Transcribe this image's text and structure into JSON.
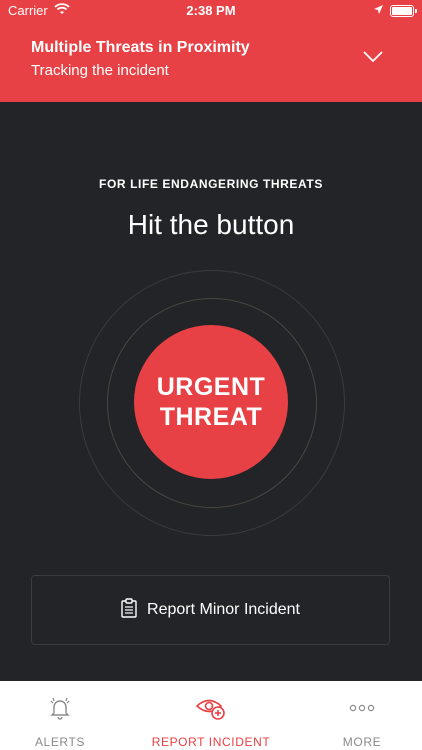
{
  "status_bar": {
    "carrier": "Carrier",
    "time": "2:38 PM"
  },
  "banner": {
    "title": "Multiple Threats in Proximity",
    "subtitle": "Tracking the incident"
  },
  "main": {
    "kicker": "FOR LIFE ENDANGERING THREATS",
    "headline": "Hit the button",
    "urgent_line1": "URGENT",
    "urgent_line2": "THREAT",
    "minor_label": "Report Minor Incident"
  },
  "tabs": [
    {
      "label": "ALERTS",
      "icon": "bell-icon",
      "active": false
    },
    {
      "label": "REPORT INCIDENT",
      "icon": "eye-plus-icon",
      "active": true
    },
    {
      "label": "MORE",
      "icon": "more-dots-icon",
      "active": false
    }
  ],
  "colors": {
    "accent": "#e84145",
    "background": "#232427",
    "inactive": "#8a8a8a"
  }
}
